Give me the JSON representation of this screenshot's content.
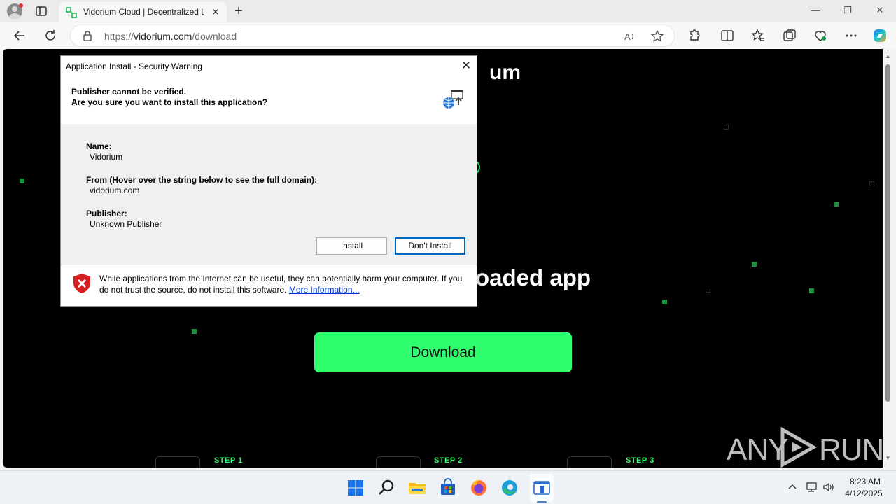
{
  "browser": {
    "tab_title": "Vidorium Cloud | Decentralized L",
    "tab_close": "✕",
    "new_tab": "+",
    "window_controls": {
      "minimize": "—",
      "restore": "❐",
      "close": "✕"
    },
    "url_prefix": "https://",
    "url_host": "vidorium.com",
    "url_path": "/download",
    "icons": [
      "back-icon",
      "refresh-icon",
      "lock-icon",
      "read-aloud-icon",
      "favorite-star-icon",
      "extensions-icon",
      "split-screen-icon",
      "favorites-icon",
      "collections-icon",
      "browser-essentials-icon",
      "more-icon",
      "copilot-icon"
    ]
  },
  "page": {
    "heading_fragment": "um",
    "subheading_fragment": "oaded app",
    "download_button": "Download",
    "steps": [
      "STEP 1",
      "STEP 2",
      "STEP 3"
    ],
    "accent_color": "#2fff6f"
  },
  "dialog": {
    "title": "Application Install - Security Warning",
    "close": "✕",
    "heading_line1": "Publisher cannot be verified.",
    "heading_line2": "Are you sure you want to install this application?",
    "name_label": "Name:",
    "name_value": "Vidorium",
    "from_label": "From (Hover over the string below to see the full domain):",
    "from_value": "vidorium.com",
    "publisher_label": "Publisher:",
    "publisher_value": "Unknown Publisher",
    "install_button": "Install",
    "dont_install_button": "Don't Install",
    "warning_text": "While applications from the Internet can be useful, they can potentially harm your computer. If you do not trust the source, do not install this software.",
    "more_info_link": "More Information..."
  },
  "watermark": {
    "text_left": "ANY",
    "text_right": "RUN"
  },
  "taskbar": {
    "apps": [
      "windows-start-icon",
      "search-icon",
      "file-explorer-icon",
      "microsoft-store-icon",
      "firefox-icon",
      "edge-icon",
      "app-installer-icon"
    ],
    "tray": [
      "chevron-up-icon",
      "network-icon",
      "volume-icon"
    ],
    "time": "8:23 AM",
    "date": "4/12/2025"
  }
}
